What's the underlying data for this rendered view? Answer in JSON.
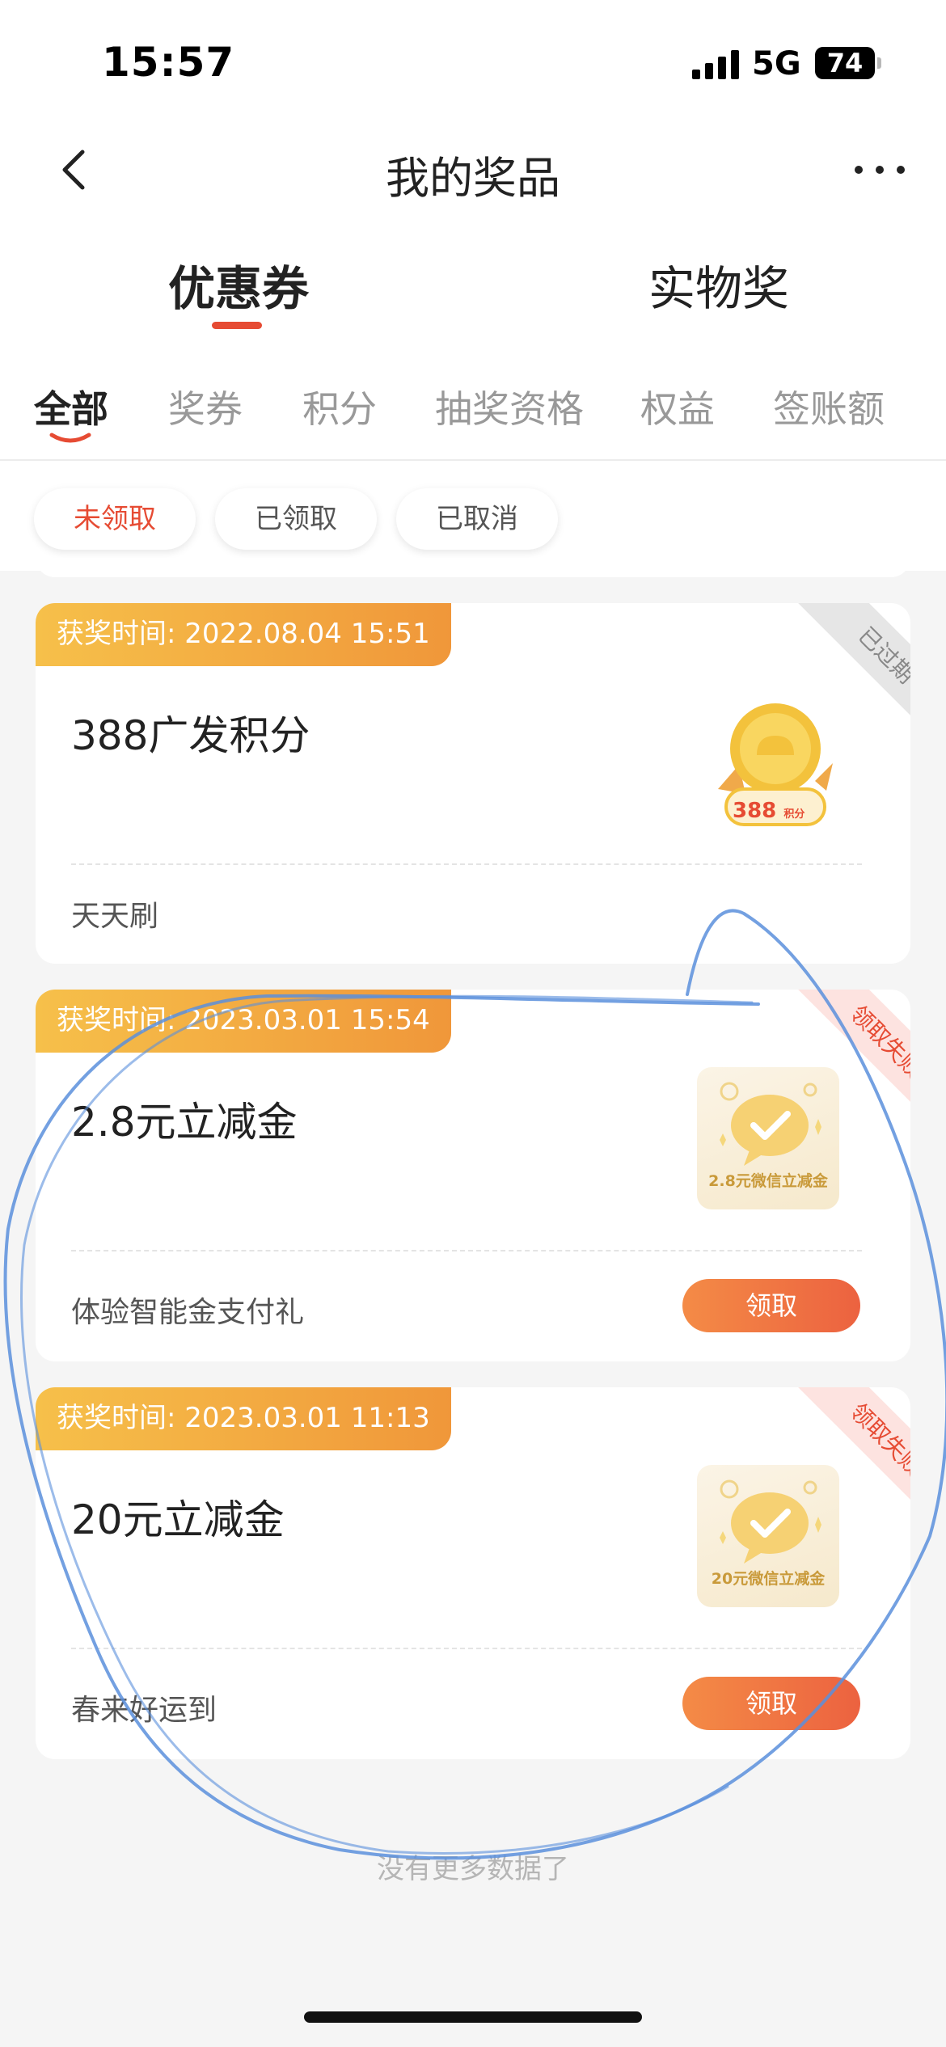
{
  "status_bar": {
    "time": "15:57",
    "network": "5G",
    "battery": "74"
  },
  "nav": {
    "title": "我的奖品",
    "back_icon": "chevron-left-icon",
    "more_icon": "more-dots-icon"
  },
  "main_tabs": [
    {
      "label": "优惠券",
      "active": true
    },
    {
      "label": "实物奖",
      "active": false
    }
  ],
  "sub_tabs": [
    {
      "label": "全部",
      "active": true
    },
    {
      "label": "奖券",
      "active": false
    },
    {
      "label": "积分",
      "active": false
    },
    {
      "label": "抽奖资格",
      "active": false
    },
    {
      "label": "权益",
      "active": false
    },
    {
      "label": "签账额",
      "active": false
    }
  ],
  "filters": [
    {
      "label": "未领取",
      "active": true
    },
    {
      "label": "已领取",
      "active": false
    },
    {
      "label": "已取消",
      "active": false
    }
  ],
  "prizes": [
    {
      "time_label": "获奖时间: 2022.08.04 15:51",
      "title": "388广发积分",
      "activity": "天天刷",
      "status": "已过期",
      "image": {
        "type": "gold-coin-icon",
        "value": "388",
        "unit": "积分"
      }
    },
    {
      "time_label": "获奖时间: 2023.03.01 15:54",
      "title": "2.8元立减金",
      "activity": "体验智能金支付礼",
      "status": "领取失败",
      "button": "领取",
      "image": {
        "type": "wechat-voucher-icon",
        "caption": "2.8元微信立减金"
      }
    },
    {
      "time_label": "获奖时间: 2023.03.01 11:13",
      "title": "20元立减金",
      "activity": "春来好运到",
      "status": "领取失败",
      "button": "领取",
      "image": {
        "type": "wechat-voucher-icon",
        "caption": "20元微信立减金"
      }
    }
  ],
  "footer": {
    "no_more": "没有更多数据了"
  },
  "colors": {
    "accent": "#e64b33",
    "tag_gradient_start": "#f6c04a",
    "tag_gradient_end": "#f0973a",
    "scribble": "#5a8fdc"
  }
}
